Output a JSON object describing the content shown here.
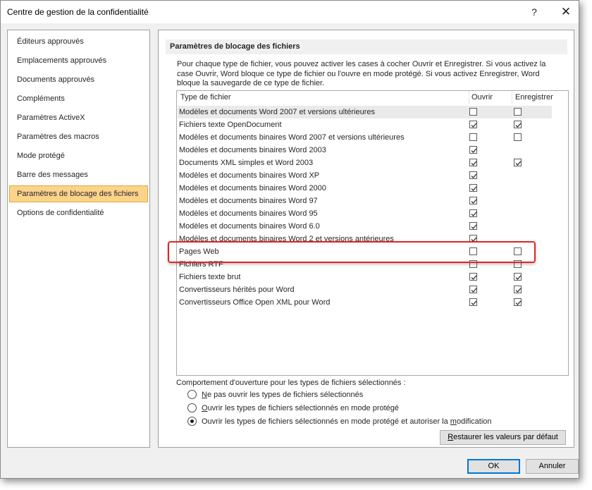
{
  "window": {
    "title": "Centre de gestion de la confidentialité",
    "help_glyph": "?",
    "close_glyph": "✕"
  },
  "sidebar": {
    "items": [
      {
        "label": "Éditeurs approuvés",
        "selected": false
      },
      {
        "label": "Emplacements approuvés",
        "selected": false
      },
      {
        "label": "Documents approuvés",
        "selected": false
      },
      {
        "label": "Compléments",
        "selected": false
      },
      {
        "label": "Paramètres ActiveX",
        "selected": false
      },
      {
        "label": "Paramètres des macros",
        "selected": false
      },
      {
        "label": "Mode protégé",
        "selected": false
      },
      {
        "label": "Barre des messages",
        "selected": false
      },
      {
        "label": "Paramètres de blocage des fichiers",
        "selected": true
      },
      {
        "label": "Options de confidentialité",
        "selected": false
      }
    ]
  },
  "main": {
    "section_title": "Paramètres de blocage des fichiers",
    "description_lines": [
      "Pour chaque type de fichier, vous pouvez activer les cases à cocher Ouvrir et Enregistrer. Si vous activez la",
      "case Ouvrir, Word bloque ce type de fichier ou l'ouvre en mode protégé. Si vous activez Enregistrer, Word",
      "bloque la sauvegarde de ce type de fichier."
    ],
    "table": {
      "headers": {
        "file_type": "Type de fichier",
        "open": "Ouvrir",
        "save": "Enregistrer"
      },
      "rows": [
        {
          "name": "Modèles et documents Word 2007 et versions ultérieures",
          "open": false,
          "save": false
        },
        {
          "name": "Fichiers texte OpenDocument",
          "open": true,
          "save": true
        },
        {
          "name": "Modèles et documents binaires Word 2007 et versions ultérieures",
          "open": false,
          "save": false
        },
        {
          "name": "Modèles et documents binaires Word 2003",
          "open": true,
          "save": null
        },
        {
          "name": "Documents XML simples et Word 2003",
          "open": true,
          "save": true
        },
        {
          "name": "Modèles et documents binaires Word XP",
          "open": true,
          "save": null
        },
        {
          "name": "Modèles et documents binaires Word 2000",
          "open": true,
          "save": null
        },
        {
          "name": "Modèles et documents binaires Word 97",
          "open": true,
          "save": null
        },
        {
          "name": "Modèles et documents binaires Word 95",
          "open": true,
          "save": null
        },
        {
          "name": "Modèles et documents binaires Word 6.0",
          "open": true,
          "save": null
        },
        {
          "name": "Modèles et documents binaires Word 2 et versions antérieures",
          "open": true,
          "save": null
        },
        {
          "name": "Pages Web",
          "open": false,
          "save": false
        },
        {
          "name": "Fichiers RTF",
          "open": false,
          "save": false
        },
        {
          "name": "Fichiers texte brut",
          "open": true,
          "save": true
        },
        {
          "name": "Convertisseurs hérités pour Word",
          "open": true,
          "save": true
        },
        {
          "name": "Convertisseurs Office Open XML pour Word",
          "open": true,
          "save": true
        }
      ]
    },
    "behavior_label": "Comportement d'ouverture pour les types de fichiers sélectionnés :",
    "options": [
      {
        "mnemonic": "N",
        "rest": "e pas ouvrir les types de fichiers sélectionnés",
        "selected": false
      },
      {
        "mnemonic": "O",
        "rest": "uvrir les types de fichiers sélectionnés en mode protégé",
        "selected": false
      },
      {
        "before": "Ouvrir les types de fichiers sélectionnés en mode protégé et autoriser la ",
        "mnemonic": "m",
        "after": "odification",
        "selected": true
      }
    ],
    "restore_button": {
      "mnemonic": "R",
      "rest": "estaurer les valeurs par défaut"
    }
  },
  "footer": {
    "ok_label": "OK",
    "cancel_label": "Annuler"
  }
}
